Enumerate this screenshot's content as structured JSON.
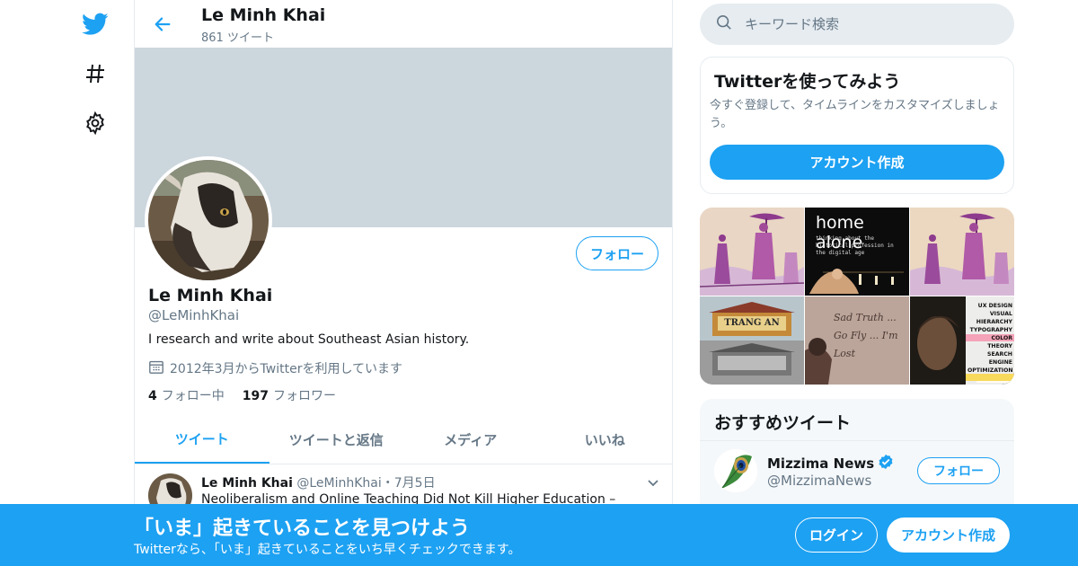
{
  "colors": {
    "brand": "#1da1f2",
    "banner": "#ccd6dd",
    "muted": "#657786",
    "text": "#14171a"
  },
  "nav": {
    "items": [
      {
        "icon": "twitter-bird-icon"
      },
      {
        "icon": "hashtag-icon"
      },
      {
        "icon": "gear-icon"
      }
    ]
  },
  "header": {
    "name": "Le Minh Khai",
    "tweet_count": "861 ツイート"
  },
  "profile": {
    "name": "Le Minh Khai",
    "handle": "@LeMinhKhai",
    "bio": "I research and write about Southeast Asian history.",
    "joined": "2012年3月からTwitterを利用しています",
    "following_count": "4",
    "following_label": "フォロー中",
    "followers_count": "197",
    "followers_label": "フォロワー",
    "follow_label": "フォロー"
  },
  "tabs": [
    {
      "label": "ツイート",
      "active": true
    },
    {
      "label": "ツイートと返信",
      "active": false
    },
    {
      "label": "メディア",
      "active": false
    },
    {
      "label": "いいね",
      "active": false
    }
  ],
  "tweet": {
    "name": "Le Minh Khai",
    "handle": "@LeMinhKhai",
    "separator": "・",
    "date": "7月5日",
    "text": "Neoliberalism and Online Teaching Did Not Kill Higher Education –"
  },
  "search": {
    "placeholder": "キーワード検索"
  },
  "promo": {
    "title": "Twitterを使ってみよう",
    "text": "今すぐ登録して、タイムラインをカスタマイズしましょう。",
    "button": "アカウント作成"
  },
  "media": {
    "home_alone_title": "home alone",
    "home_alone_sub": "thinking about the historical profession in the digital age",
    "trang_an_text": "TRANG AN",
    "sand_text": "Sad Truth ... Go Fly ... I'm Lost",
    "ux_lines": [
      "UX DESIGN",
      "VISUAL",
      "HIERARCHY",
      "TYPOGRAPHY",
      "COLOR",
      "THEORY",
      "SEARCH",
      "ENGINE",
      "OPTIMIZATION"
    ]
  },
  "recommended": {
    "title": "おすすめツイート",
    "name": "Mizzima News",
    "handle": "@MizzimaNews",
    "follow_label": "フォロー"
  },
  "bottom_bar": {
    "title": "「いま」起きていることを見つけよう",
    "subtitle": "Twitterなら、「いま」起きていることをいち早くチェックできます。",
    "login": "ログイン",
    "signup": "アカウント作成"
  }
}
